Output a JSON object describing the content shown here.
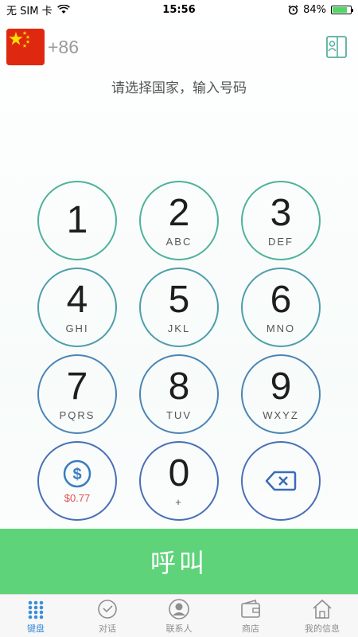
{
  "status_bar": {
    "carrier": "无 SIM 卡",
    "time": "15:56",
    "battery": "84%",
    "battery_level": 0.84
  },
  "header": {
    "country_code": "+86",
    "hint": "请选择国家，输入号码"
  },
  "keypad": {
    "keys": [
      {
        "digit": "1",
        "letters": ""
      },
      {
        "digit": "2",
        "letters": "ABC"
      },
      {
        "digit": "3",
        "letters": "DEF"
      },
      {
        "digit": "4",
        "letters": "GHI"
      },
      {
        "digit": "5",
        "letters": "JKL"
      },
      {
        "digit": "6",
        "letters": "MNO"
      },
      {
        "digit": "7",
        "letters": "PQRS"
      },
      {
        "digit": "8",
        "letters": "TUV"
      },
      {
        "digit": "9",
        "letters": "WXYZ"
      },
      {
        "digit": "0",
        "letters": "+"
      }
    ],
    "balance": "$0.77"
  },
  "call_button": "呼叫",
  "tabs": [
    {
      "label": "键盘",
      "icon": "keypad-icon"
    },
    {
      "label": "对话",
      "icon": "history-icon"
    },
    {
      "label": "联系人",
      "icon": "contact-icon"
    },
    {
      "label": "商店",
      "icon": "wallet-icon"
    },
    {
      "label": "我的信息",
      "icon": "home-icon"
    }
  ],
  "colors": {
    "call_green": "#5ed37a",
    "active_tab": "#3a8fd8",
    "price_red": "#e05050",
    "flag_red": "#de2910"
  }
}
